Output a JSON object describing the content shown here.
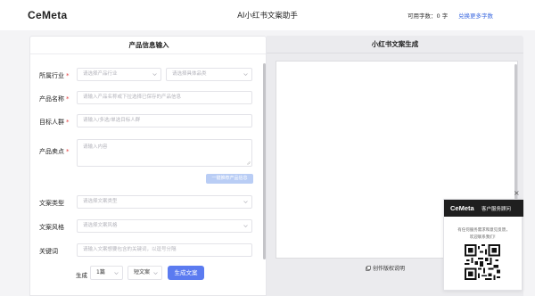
{
  "header": {
    "logo": "CeMeta",
    "title": "AI小红书文案助手",
    "quota": "可用字数：0 字",
    "buy_more": "兑换更多字数"
  },
  "left_panel": {
    "title": "产品信息输入",
    "industry": {
      "label": "所属行业",
      "required": "*",
      "industry_placeholder": "请选择产品行业",
      "category_placeholder": "请选择具体品类"
    },
    "product_name": {
      "label": "产品名称",
      "required": "*",
      "placeholder": "请输入产品名称或下拉选择已保存的产品信息"
    },
    "audience": {
      "label": "目标人群",
      "required": "*",
      "placeholder": "请输入/多选/单选目标人群"
    },
    "selling_points": {
      "label": "产品卖点",
      "required": "*",
      "placeholder": "请输入内容"
    },
    "ai_button": "一键推荐产品信息",
    "copy_type": {
      "label": "文案类型",
      "placeholder": "请选择文案类型"
    },
    "copy_style": {
      "label": "文案风格",
      "placeholder": "请选择文案风格"
    },
    "keywords": {
      "label": "关键词",
      "placeholder": "请输入文案想要包含的关键词，以逗号分隔"
    },
    "generate": {
      "label": "生成",
      "count": "1篇",
      "length": "短文案",
      "button": "生成文案"
    }
  },
  "right_panel": {
    "title": "小红书文案生成",
    "copyright": "创作版权说明"
  },
  "customer_service": {
    "close": "×",
    "logo": "CeMeta",
    "title": "客户服务顾问",
    "text1": "有任何服务需求和意见反馈，",
    "text2": "欢迎联系我们！"
  }
}
